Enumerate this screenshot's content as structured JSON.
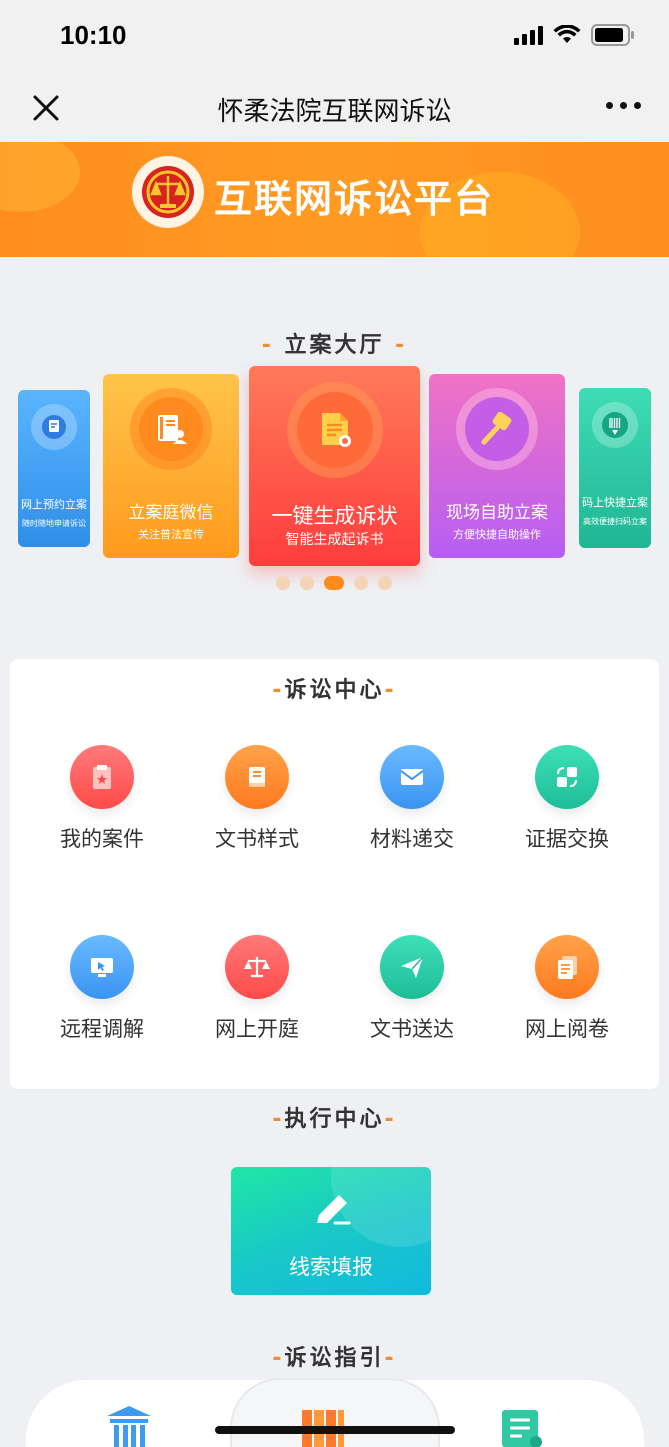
{
  "status_bar": {
    "time": "10:10"
  },
  "nav": {
    "title": "怀柔法院互联网诉讼"
  },
  "banner": {
    "title": "互联网诉讼平台"
  },
  "filing_hall": {
    "title": "立案大厅",
    "cards": [
      {
        "title": "网上预约立案",
        "subtitle": "随时随地申请诉讼",
        "icon": "monitor-icon",
        "color": "#3b9cf0"
      },
      {
        "title": "立案庭微信",
        "subtitle": "关注普法宣传",
        "icon": "book-user-icon",
        "color": "#ffa52a"
      },
      {
        "title": "一键生成诉状",
        "subtitle": "智能生成起诉书",
        "icon": "document-seal-icon",
        "color": "#ff5246"
      },
      {
        "title": "现场自助立案",
        "subtitle": "方便快捷自助操作",
        "icon": "gavel-icon",
        "color": "#c65ef0"
      },
      {
        "title": "码上快捷立案",
        "subtitle": "高效便捷扫码立案",
        "icon": "barcode-pen-icon",
        "color": "#25c7a7"
      }
    ],
    "active_index": 2
  },
  "litigation_center": {
    "title": "诉讼中心",
    "items": [
      {
        "label": "我的案件",
        "icon": "clipboard-star-icon",
        "color": "#ff5a5a"
      },
      {
        "label": "文书样式",
        "icon": "book-icon",
        "color": "#ff8a2a"
      },
      {
        "label": "材料递交",
        "icon": "envelope-icon",
        "color": "#3ea4f5"
      },
      {
        "label": "证据交换",
        "icon": "exchange-icon",
        "color": "#22c9a3"
      },
      {
        "label": "远程调解",
        "icon": "remote-screen-icon",
        "color": "#3ea4f5"
      },
      {
        "label": "网上开庭",
        "icon": "scales-icon",
        "color": "#ff5a5a"
      },
      {
        "label": "文书送达",
        "icon": "paper-plane-icon",
        "color": "#22c9a3"
      },
      {
        "label": "网上阅卷",
        "icon": "files-icon",
        "color": "#ff8a2a"
      }
    ]
  },
  "execution_center": {
    "title": "执行中心",
    "button_label": "线索填报",
    "icon": "pencil-icon"
  },
  "guide": {
    "title": "诉讼指引",
    "icons": [
      "courthouse-icon",
      "books-icon",
      "document-list-icon"
    ]
  }
}
